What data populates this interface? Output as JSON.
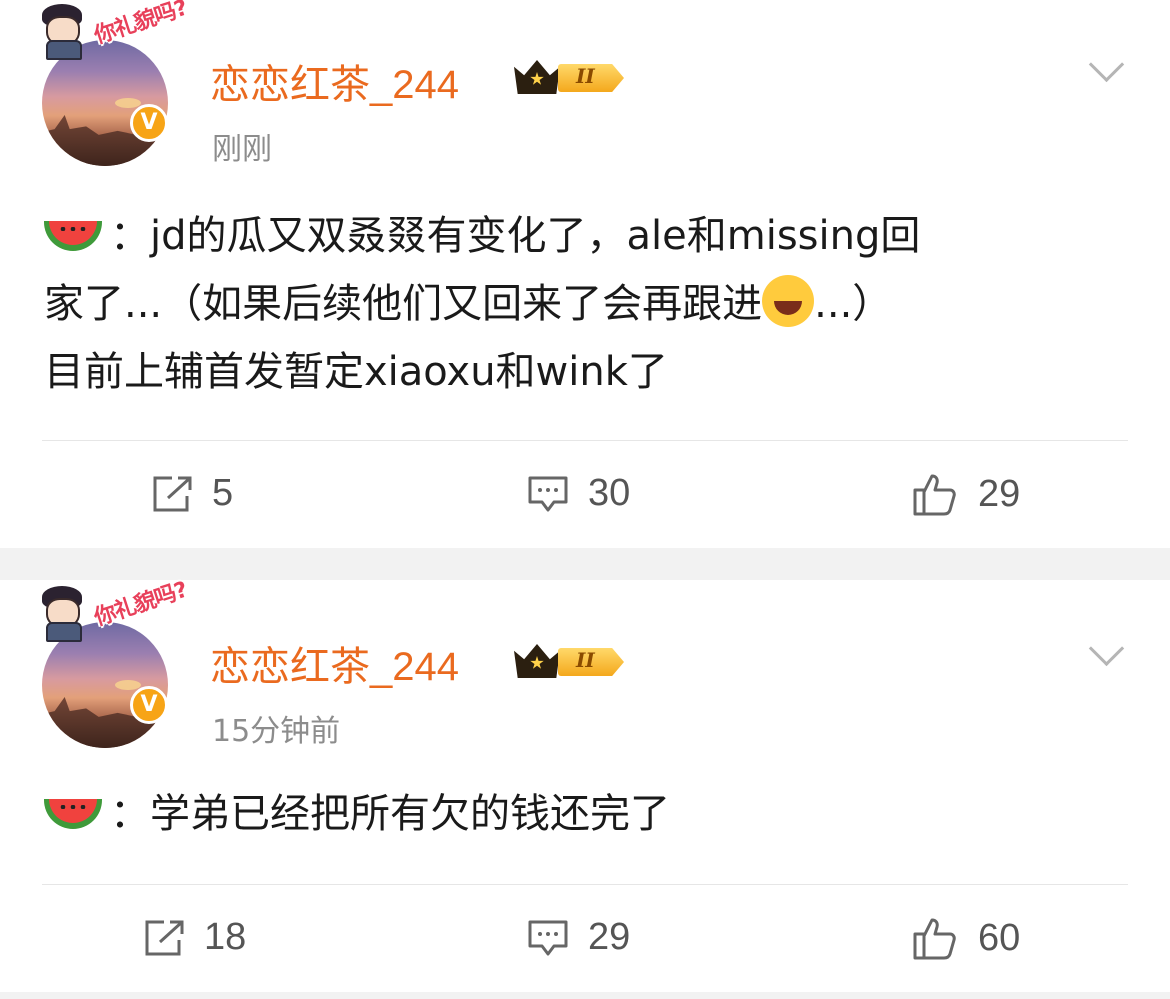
{
  "posts": [
    {
      "username": "恋恋红茶_244",
      "timestamp": "刚刚",
      "avatar_sticker_text": "你礼貌吗?",
      "level_badge": "II",
      "verified_badge": "V",
      "content_lines": [
        "：jd的瓜又双叒叕有变化了，ale和missing回",
        "家了...（如果后续他们又回来了会再跟进",
        "...）",
        "目前上辅首发暂定xiaoxu和wink了"
      ],
      "emoji": [
        "watermelon-emoji",
        "laughing-tears-emoji"
      ],
      "actions": {
        "repost": "5",
        "comment": "30",
        "like": "29"
      }
    },
    {
      "username": "恋恋红茶_244",
      "timestamp": "15分钟前",
      "avatar_sticker_text": "你礼貌吗?",
      "level_badge": "II",
      "verified_badge": "V",
      "content_lines": [
        "：学弟已经把所有欠的钱还完了"
      ],
      "emoji": [
        "watermelon-emoji"
      ],
      "actions": {
        "repost": "18",
        "comment": "29",
        "like": "60"
      }
    }
  ],
  "colors": {
    "username": "#ea6a1f",
    "timestamp": "#8c8c8c",
    "text": "#1a1a1a",
    "separator_background": "#f2f2f2",
    "verified": "#f7a416"
  }
}
